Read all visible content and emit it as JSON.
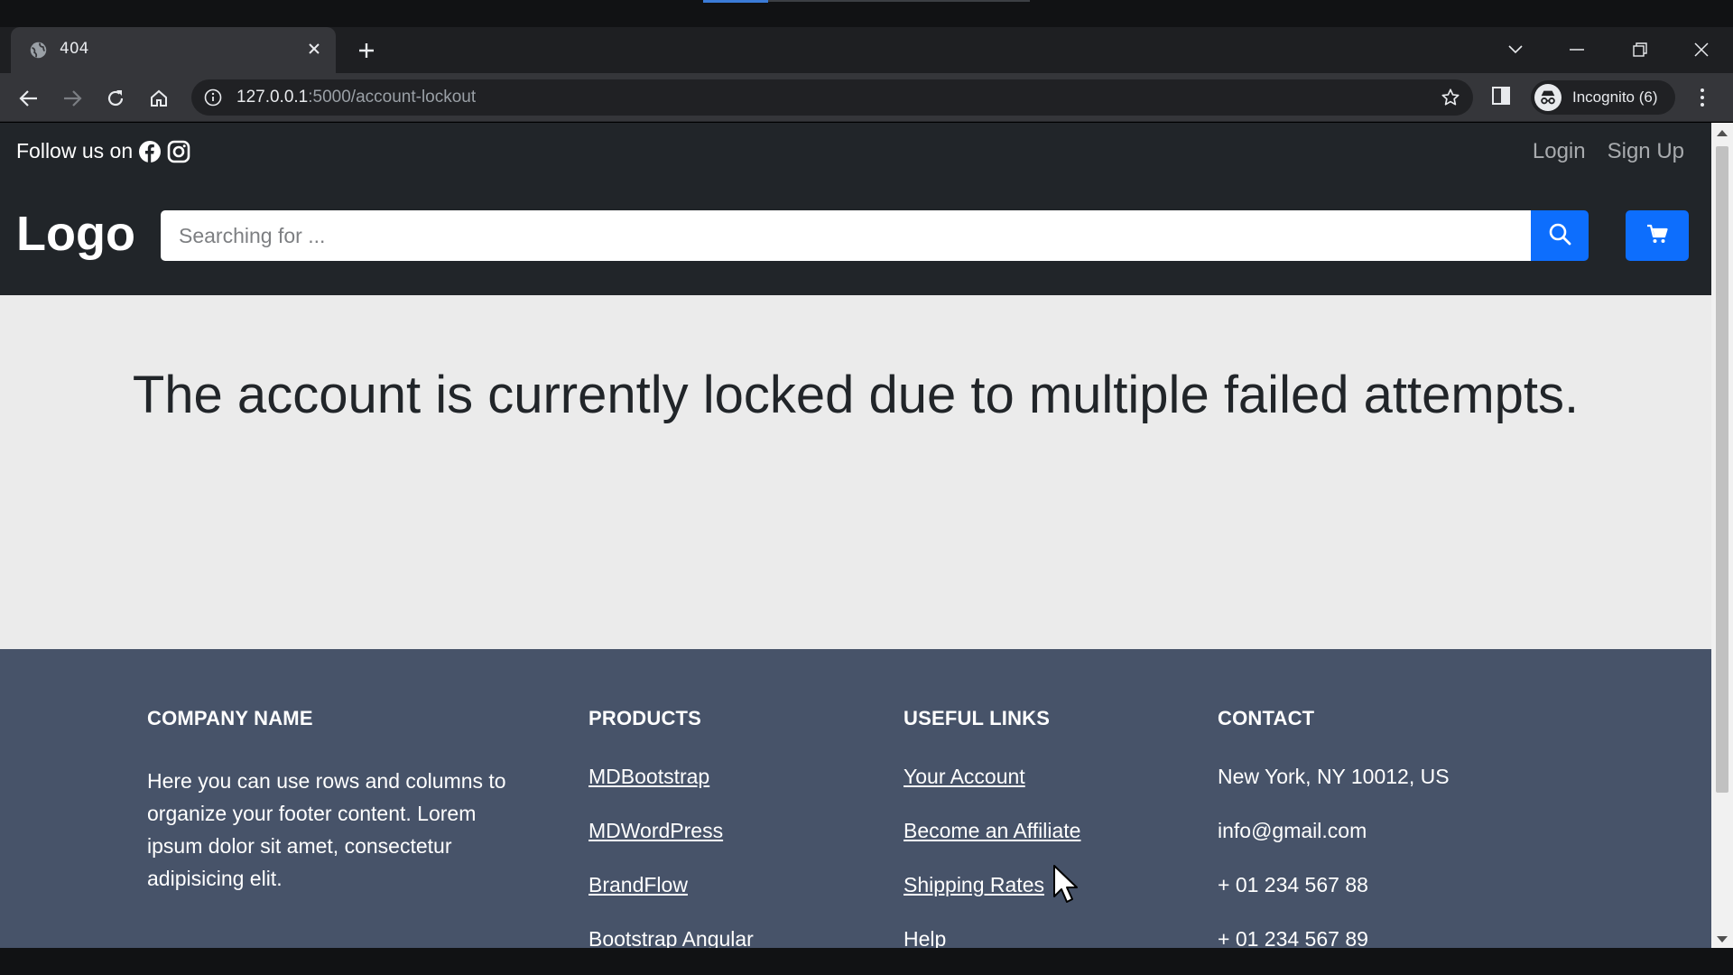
{
  "browser": {
    "tab_title": "404",
    "url_host": "127.0.0.1",
    "url_path": ":5000/account-lockout",
    "profile_label": "Incognito (6)"
  },
  "header": {
    "follow_label": "Follow us on",
    "login_label": "Login",
    "signup_label": "Sign Up",
    "logo_text": "Logo",
    "search_placeholder": "Searching for ..."
  },
  "main": {
    "message": "The account is currently locked due to multiple failed attempts."
  },
  "footer": {
    "company": {
      "heading": "COMPANY NAME",
      "text": "Here you can use rows and columns to organize your footer content. Lorem ipsum dolor sit amet, consectetur adipisicing elit."
    },
    "products": {
      "heading": "PRODUCTS",
      "items": [
        "MDBootstrap",
        "MDWordPress",
        "BrandFlow",
        "Bootstrap Angular"
      ]
    },
    "useful_links": {
      "heading": "USEFUL LINKS",
      "items": [
        "Your Account",
        "Become an Affiliate",
        "Shipping Rates",
        "Help"
      ]
    },
    "contact": {
      "heading": "CONTACT",
      "items": [
        "New York, NY 10012, US",
        "info@gmail.com",
        "+ 01 234 567 88",
        "+ 01 234 567 89"
      ]
    }
  },
  "colors": {
    "header_bg": "#212529",
    "footer_bg": "#475369",
    "accent": "#0d6efd",
    "page_bg": "#ebebeb"
  }
}
